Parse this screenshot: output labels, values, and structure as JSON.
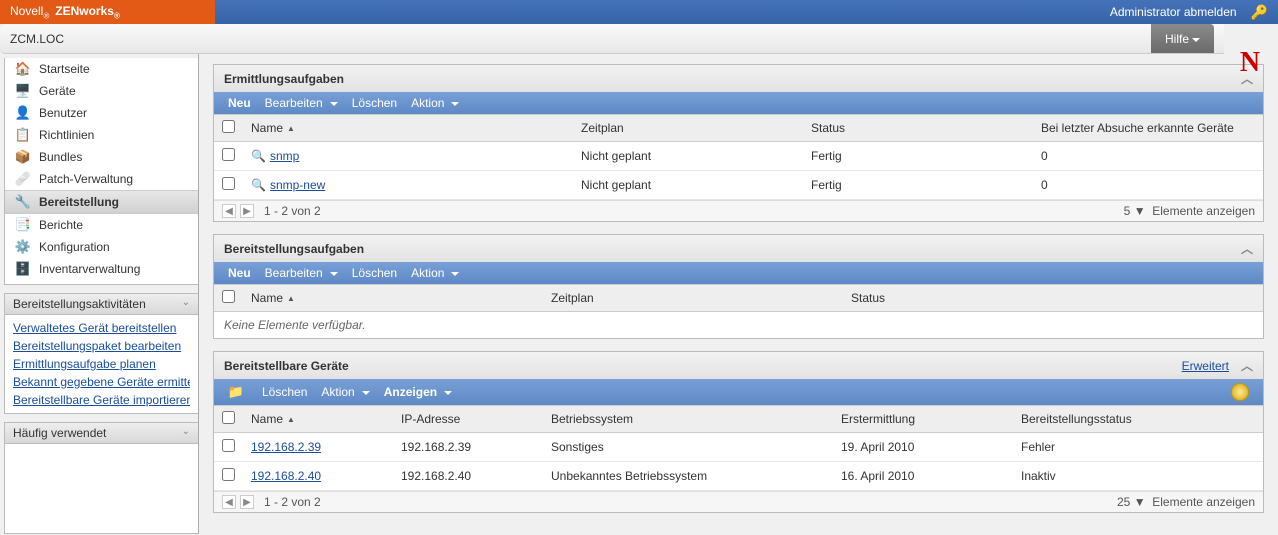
{
  "header": {
    "brand_left": "Novell",
    "brand_right": "ZENworks",
    "logout": "Administrator abmelden",
    "breadcrumb": "ZCM.LOC",
    "help": "Hilfe"
  },
  "sidebar": {
    "items": [
      {
        "label": "Startseite",
        "icon": "🏠"
      },
      {
        "label": "Geräte",
        "icon": "🖥️"
      },
      {
        "label": "Benutzer",
        "icon": "👤"
      },
      {
        "label": "Richtlinien",
        "icon": "📋"
      },
      {
        "label": "Bundles",
        "icon": "📦"
      },
      {
        "label": "Patch-Verwaltung",
        "icon": "🩹"
      },
      {
        "label": "Bereitstellung",
        "icon": "🔧",
        "selected": true
      },
      {
        "label": "Berichte",
        "icon": "📑"
      },
      {
        "label": "Konfiguration",
        "icon": "⚙️"
      },
      {
        "label": "Inventarverwaltung",
        "icon": "🗄️"
      }
    ],
    "activities": {
      "title": "Bereitstellungsaktivitäten",
      "links": [
        "Verwaltetes Gerät bereitstellen",
        "Bereitstellungspaket bearbeiten",
        "Ermittlungsaufgabe planen",
        "Bekannt gegebene Geräte ermitteln",
        "Bereitstellbare Geräte importieren"
      ]
    },
    "frequent": {
      "title": "Häufig verwendet"
    }
  },
  "panel1": {
    "title": "Ermittlungsaufgaben",
    "toolbar": {
      "neu": "Neu",
      "bearb": "Bearbeiten",
      "loesch": "Löschen",
      "aktion": "Aktion"
    },
    "cols": {
      "name": "Name",
      "zeit": "Zeitplan",
      "status": "Status",
      "last": "Bei letzter Absuche erkannte Geräte"
    },
    "rows": [
      {
        "name": "snmp",
        "zeit": "Nicht geplant",
        "status": "Fertig",
        "count": "0"
      },
      {
        "name": "snmp-new",
        "zeit": "Nicht geplant",
        "status": "Fertig",
        "count": "0"
      }
    ],
    "pager_text": "1 - 2 von 2",
    "pager_right_count": "5",
    "pager_right_label": "Elemente anzeigen"
  },
  "panel2": {
    "title": "Bereitstellungsaufgaben",
    "toolbar": {
      "neu": "Neu",
      "bearb": "Bearbeiten",
      "loesch": "Löschen",
      "aktion": "Aktion"
    },
    "cols": {
      "name": "Name",
      "zeit": "Zeitplan",
      "status": "Status"
    },
    "empty": "Keine Elemente verfügbar."
  },
  "panel3": {
    "title": "Bereitstellbare Geräte",
    "expand": "Erweitert",
    "toolbar": {
      "loesch": "Löschen",
      "aktion": "Aktion",
      "anzeigen": "Anzeigen"
    },
    "cols": {
      "name": "Name",
      "ip": "IP-Adresse",
      "os": "Betriebssystem",
      "erst": "Erstermittlung",
      "bstat": "Bereitstellungsstatus"
    },
    "rows": [
      {
        "name": "192.168.2.39",
        "ip": "192.168.2.39",
        "os": "Sonstiges",
        "erst": "19. April 2010",
        "bstat": "Fehler",
        "error": true
      },
      {
        "name": "192.168.2.40",
        "ip": "192.168.2.40",
        "os": "Unbekanntes Betriebssystem",
        "erst": "16. April 2010",
        "bstat": "Inaktiv"
      }
    ],
    "pager_text": "1 - 2 von 2",
    "pager_right_count": "25",
    "pager_right_label": "Elemente anzeigen"
  }
}
